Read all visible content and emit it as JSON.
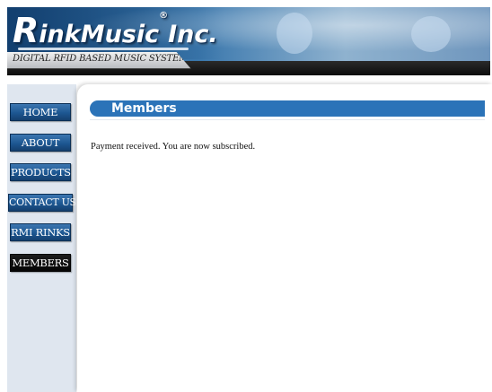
{
  "header": {
    "logo_main": "R",
    "logo_rest": "inkMusic",
    "logo_reg": "®",
    "logo_suffix": "Inc.",
    "tagline": "DIGITAL RFID BASED MUSIC SYSTEMS"
  },
  "nav": [
    {
      "label": "HOME"
    },
    {
      "label": "ABOUT"
    },
    {
      "label": "PRODUCTS"
    },
    {
      "label": "CONTACT US"
    },
    {
      "label": "RMI RINKS"
    },
    {
      "label": "MEMBERS"
    }
  ],
  "main": {
    "title": "Members",
    "message": "Payment received. You are now subscribed."
  },
  "colors": {
    "nav_button": "#1d5792",
    "nav_active": "#0a0a0a",
    "title_bar": "#2b73b8",
    "sidebar_bg": "#dfe6ef"
  }
}
